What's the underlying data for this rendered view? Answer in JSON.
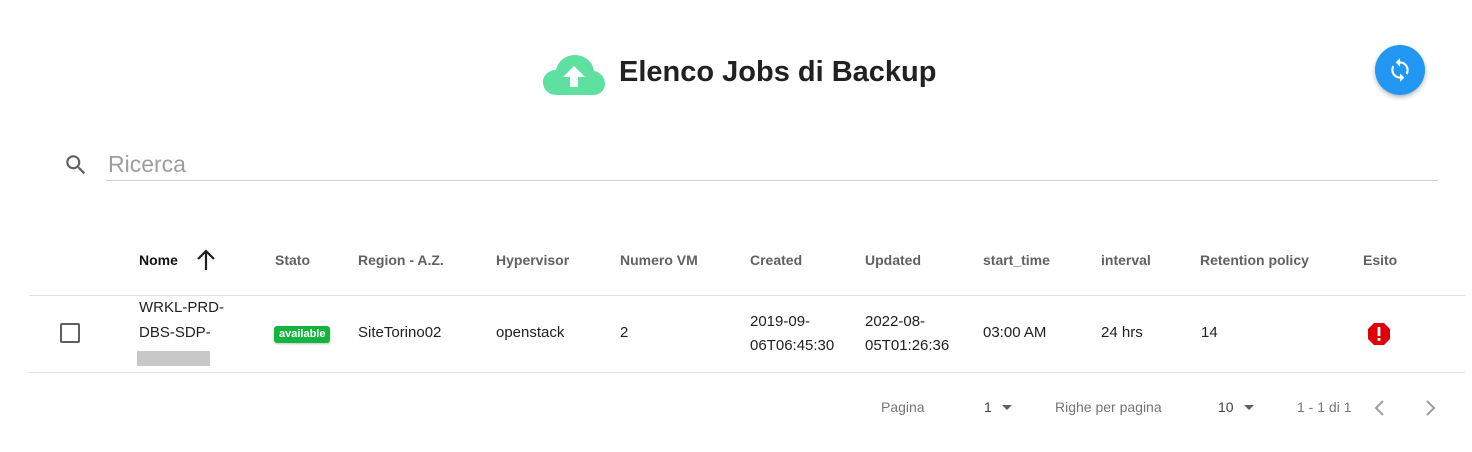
{
  "header": {
    "title": "Elenco Jobs di Backup",
    "cloud_icon": "cloud-upload-icon",
    "refresh_icon": "refresh-icon",
    "accent": "#2196f3",
    "cloud_color": "#5ee0a0"
  },
  "search": {
    "placeholder": "Ricerca",
    "value": ""
  },
  "table": {
    "columns": [
      "Nome",
      "Stato",
      "Region - A.Z.",
      "Hypervisor",
      "Numero VM",
      "Created",
      "Updated",
      "start_time",
      "interval",
      "Retention policy",
      "Esito"
    ],
    "sort": {
      "column": "Nome",
      "direction": "ascending",
      "icon": "arrow-up-icon"
    },
    "rows": [
      {
        "nome": [
          "WRKL-PRD-",
          "DBS-SDP-"
        ],
        "stato": "available",
        "stato_color": "#14b53e",
        "region": "SiteTorino02",
        "hypervisor": "openstack",
        "numero_vm": "2",
        "created": [
          "2019-09-",
          "06T06:45:30"
        ],
        "updated": [
          "2022-08-",
          "05T01:26:36"
        ],
        "start_time": "03:00 AM",
        "interval": "24 hrs",
        "retention": "14",
        "esito_icon": "error-icon",
        "esito_color": "#e0000a"
      }
    ]
  },
  "pagination": {
    "page_label": "Pagina",
    "page": "1",
    "rows_label": "Righe per pagina",
    "rows_per_page": "10",
    "range": "1 - 1 di 1",
    "prev_icon": "chevron-left-icon",
    "next_icon": "chevron-right-icon"
  }
}
